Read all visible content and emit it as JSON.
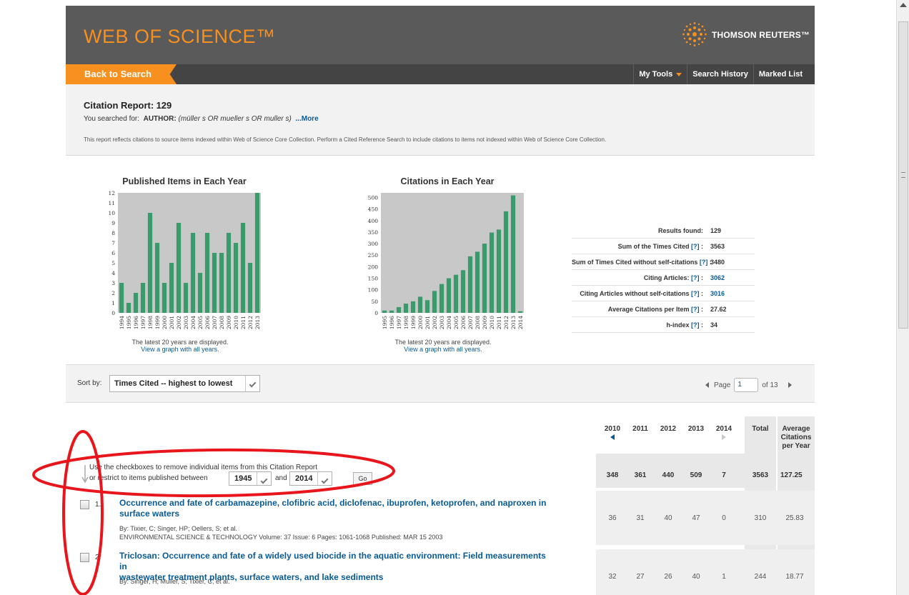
{
  "header": {
    "brand": "WEB OF SCIENCE™",
    "publisher": "THOMSON REUTERS™",
    "back_label": "Back to Search",
    "nav": {
      "my_tools": "My Tools",
      "search_history": "Search History",
      "marked_list": "Marked List"
    }
  },
  "report": {
    "title_prefix": "Citation Report:",
    "count": "129",
    "searched_prefix": "You searched for:",
    "searched_field": "AUTHOR:",
    "searched_query": "(müller s OR mueller s OR muller s)",
    "more": "...More",
    "note": "This report reflects citations to source items indexed within Web of Science Core Collection. Perform a Cited Reference Search to include citations to items not indexed within Web of Science Core Collection."
  },
  "chart_data": [
    {
      "type": "bar",
      "title": "Published Items in Each Year",
      "categories": [
        "1994",
        "1995",
        "1996",
        "1997",
        "1998",
        "1999",
        "2000",
        "2001",
        "2002",
        "2003",
        "2004",
        "2005",
        "2006",
        "2007",
        "2008",
        "2009",
        "2010",
        "2011",
        "2012",
        "2013"
      ],
      "values": [
        3,
        1,
        2,
        3,
        10,
        7,
        3,
        5,
        9,
        3,
        8,
        4,
        8,
        6,
        6,
        8,
        7,
        9,
        5,
        12
      ],
      "ylim": [
        0,
        12
      ],
      "yticks": [
        0,
        1,
        2,
        3,
        4,
        5,
        6,
        7,
        8,
        9,
        10,
        11,
        12
      ],
      "grid": false,
      "color": "#3a9b6a"
    },
    {
      "type": "bar",
      "title": "Citations in Each Year",
      "categories": [
        "1995",
        "1996",
        "1997",
        "1998",
        "1999",
        "2000",
        "2001",
        "2002",
        "2003",
        "2004",
        "2005",
        "2006",
        "2007",
        "2008",
        "2009",
        "2010",
        "2011",
        "2012",
        "2013",
        "2014"
      ],
      "values": [
        10,
        10,
        25,
        40,
        50,
        70,
        55,
        95,
        125,
        150,
        165,
        185,
        245,
        265,
        300,
        348,
        361,
        440,
        509,
        7
      ],
      "ylim": [
        0,
        520
      ],
      "yticks": [
        0,
        50,
        100,
        150,
        200,
        250,
        300,
        350,
        400,
        450,
        500
      ],
      "grid": false,
      "color": "#3a9b6a"
    }
  ],
  "charts": {
    "caption": "The latest 20 years are displayed.",
    "link": "View a graph with all years."
  },
  "stats": [
    {
      "label": "Results found:",
      "q": "",
      "value": "129",
      "link": false
    },
    {
      "label": "Sum of the Times Cited",
      "q": "[?]",
      "value": "3563",
      "link": false
    },
    {
      "label": "Sum of Times Cited without self-citations",
      "q": "[?]",
      "value": "3480",
      "link": false
    },
    {
      "label": "Citing Articles:",
      "q": "[?]",
      "value": "3062",
      "link": true
    },
    {
      "label": "Citing Articles without self-citations",
      "q": "[?]",
      "value": "3016",
      "link": true
    },
    {
      "label": "Average Citations per Item",
      "q": "[?]",
      "value": "27.62",
      "link": false
    },
    {
      "label": "h-index",
      "q": "[?]",
      "value": "34",
      "link": false
    }
  ],
  "sort": {
    "label": "Sort by:",
    "value": "Times Cited -- highest to lowest"
  },
  "pager": {
    "page_label": "Page",
    "page": "1",
    "of_label": "of 13"
  },
  "table": {
    "years": [
      "2010",
      "2011",
      "2012",
      "2013",
      "2014"
    ],
    "total_header": "Total",
    "avg_header_1": "Average",
    "avg_header_2": "Citations",
    "avg_header_3": "per Year",
    "filter_line1": "Use the checkboxes to remove individual items from this Citation Report",
    "filter_line2": "or restrict to items published between",
    "from_year": "1945",
    "and_label": "and",
    "to_year": "2014",
    "go_label": "Go",
    "totals": [
      "348",
      "361",
      "440",
      "509",
      "7",
      "3563",
      "127.25"
    ]
  },
  "records": [
    {
      "index": "1.",
      "title_line1": "Occurrence and fate of carbamazepine, clofibric acid, diclofenac, ibuprofen, ketoprofen, and naproxen in",
      "title_line2": "surface waters",
      "authors": "By: Tixier, C; Singer, HP; Oellers, S; et al.",
      "source": "ENVIRONMENTAL SCIENCE & TECHNOLOGY  Volume: 37  Issue: 6  Pages: 1061-1068  Published: MAR 15 2003",
      "cites": [
        "36",
        "31",
        "40",
        "47",
        "0",
        "310",
        "25.83"
      ]
    },
    {
      "index": "2.",
      "title_line1": "Triclosan: Occurrence and fate of a widely used biocide in the aquatic environment: Field measurements in",
      "title_line2": "wastewater treatment plants, surface waters, and lake sediments",
      "authors": "By: Singer, H; Muller, S; Tixier, C; et al.",
      "cites": [
        "32",
        "27",
        "26",
        "40",
        "1",
        "244",
        "18.77"
      ]
    }
  ],
  "colors": {
    "accent": "#f7901e",
    "header": "#5a5a5a",
    "link": "#0a5a96",
    "bar": "#3a9b6a",
    "annotation": "#e8161c"
  }
}
